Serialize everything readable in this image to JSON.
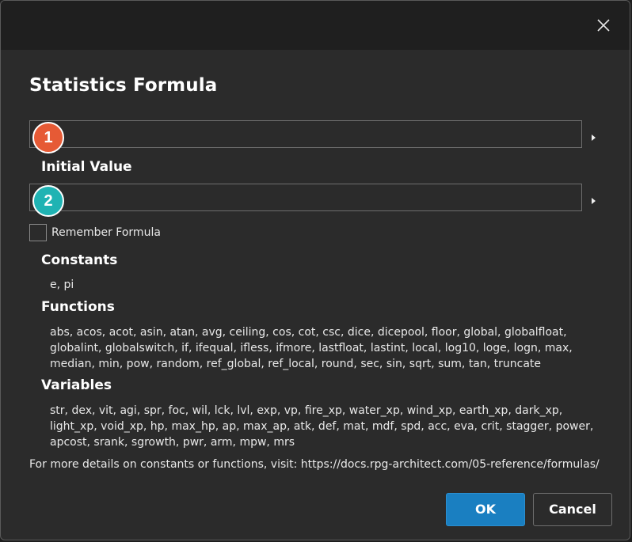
{
  "dialog": {
    "title": "Statistics Formula",
    "close_icon": "close-icon"
  },
  "formula_field": {
    "value": "",
    "badge": "1",
    "badge_color": "#e65a35"
  },
  "initial_value": {
    "label": "Initial Value",
    "value": "",
    "badge": "2",
    "badge_color": "#1fb3b3"
  },
  "remember": {
    "label": "Remember Formula",
    "checked": false
  },
  "constants": {
    "label": "Constants",
    "text": "e, pi"
  },
  "functions": {
    "label": "Functions",
    "text": "abs, acos, acot, asin, atan, avg, ceiling, cos, cot, csc, dice, dicepool, floor, global, globalfloat, globalint, globalswitch, if, ifequal, ifless, ifmore, lastfloat, lastint, local, log10, loge, logn, max, median, min, pow, random, ref_global, ref_local, round, sec, sin, sqrt, sum, tan, truncate"
  },
  "variables": {
    "label": "Variables",
    "text": "str, dex, vit, agi, spr, foc, wil, lck, lvl, exp, vp, fire_xp, water_xp, wind_xp, earth_xp, dark_xp, light_xp, void_xp, hp, max_hp, ap, max_ap, atk, def, mat, mdf, spd, acc, eva, crit, stagger, power, apcost, srank, sgrowth, pwr, arm, mpw, mrs"
  },
  "footer": {
    "text": "For more details on constants or functions, visit: https://docs.rpg-architect.com/05-reference/formulas/"
  },
  "buttons": {
    "ok": "OK",
    "cancel": "Cancel"
  },
  "colors": {
    "accent": "#1a7fc1",
    "background": "#2b2b2b",
    "titlebar": "#1f1f1f"
  }
}
